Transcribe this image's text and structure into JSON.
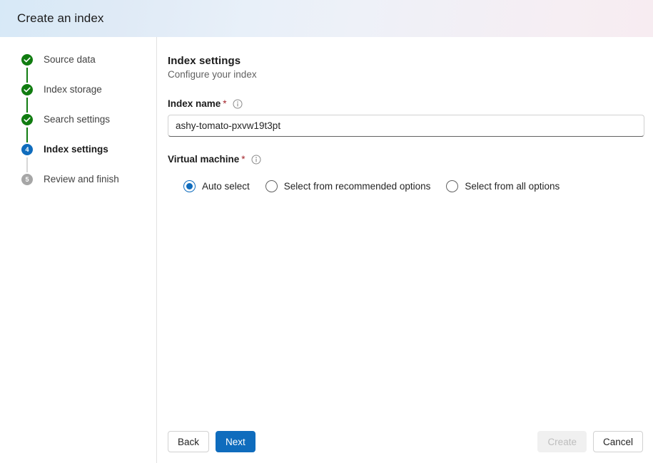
{
  "header": {
    "title": "Create an index"
  },
  "wizard": {
    "steps": [
      {
        "label": "Source data",
        "state": "done",
        "marker": "check-icon"
      },
      {
        "label": "Index storage",
        "state": "done",
        "marker": "check-icon"
      },
      {
        "label": "Search settings",
        "state": "done",
        "marker": "check-icon"
      },
      {
        "label": "Index settings",
        "state": "active",
        "marker": "4"
      },
      {
        "label": "Review and finish",
        "state": "pending",
        "marker": "5"
      }
    ]
  },
  "main": {
    "title": "Index settings",
    "subtitle": "Configure your index",
    "index_name": {
      "label": "Index name",
      "required_mark": "*",
      "info_icon": "info-icon",
      "value": "ashy-tomato-pxvw19t3pt",
      "placeholder": ""
    },
    "virtual_machine": {
      "label": "Virtual machine",
      "required_mark": "*",
      "info_icon": "info-icon",
      "selected": "Auto select",
      "options": [
        {
          "label": "Auto select",
          "checked": true
        },
        {
          "label": "Select from recommended options",
          "checked": false
        },
        {
          "label": "Select from all options",
          "checked": false
        }
      ]
    }
  },
  "footer": {
    "back_label": "Back",
    "next_label": "Next",
    "create_label": "Create",
    "cancel_label": "Cancel"
  },
  "colors": {
    "accent_blue": "#0f6cbd",
    "success_green": "#107c10",
    "pending_grey": "#a6a6a6",
    "required_red": "#a4262c"
  }
}
